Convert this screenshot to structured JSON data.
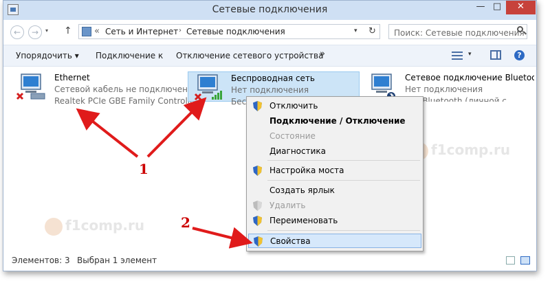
{
  "window": {
    "title": "Сетевые подключения",
    "controls": {
      "minimize": "—",
      "maximize": "□",
      "close": "✕"
    }
  },
  "nav": {
    "back": "←",
    "forward": "→",
    "recent": "▾",
    "up": "↑",
    "address_sep": "«",
    "breadcrumb": [
      "Сеть и Интернет",
      "Сетевые подключения"
    ],
    "crumb_arrow": "›",
    "address_dropdown": "▾",
    "refresh": "↻",
    "search_placeholder": "Поиск: Сетевые подключения"
  },
  "toolbar": {
    "organize": "Упорядочить ▾",
    "connect": "Подключение к",
    "disconnect": "Отключение сетевого устройства",
    "more": "»",
    "view_dropdown": "▾",
    "help": "?"
  },
  "connections": [
    {
      "name": "Ethernet",
      "status": "Сетевой кабель не подключен",
      "device": "Realtek PCIe GBE Family Controller",
      "selected": false
    },
    {
      "name": "Беспроводная сеть",
      "status": "Нет подключения",
      "device": "Беспр",
      "selected": true
    },
    {
      "name": "Сетевое подключение Bluetooth",
      "status": "Нет подключения",
      "device": "сти Bluetooth (личной с",
      "selected": false
    }
  ],
  "context_menu": [
    {
      "label": "Отключить",
      "shield": true,
      "bold": false,
      "disabled": false
    },
    {
      "label": "Подключение / Отключение",
      "shield": false,
      "bold": true,
      "disabled": false
    },
    {
      "label": "Состояние",
      "shield": false,
      "bold": false,
      "disabled": true
    },
    {
      "label": "Диагностика",
      "shield": false,
      "bold": false,
      "disabled": false
    },
    {
      "label": "Настройка моста",
      "shield": true,
      "bold": false,
      "disabled": false
    },
    {
      "label": "Создать ярлык",
      "shield": false,
      "bold": false,
      "disabled": false
    },
    {
      "label": "Удалить",
      "shield": true,
      "bold": false,
      "disabled": true
    },
    {
      "label": "Переименовать",
      "shield": true,
      "bold": false,
      "disabled": false
    },
    {
      "label": "Свойства",
      "shield": true,
      "bold": false,
      "disabled": false,
      "highlighted": true
    }
  ],
  "status": {
    "count": "Элементов: 3",
    "selected": "Выбран 1 элемент"
  },
  "callouts": {
    "one": "1",
    "two": "2"
  },
  "watermark": "f1comp.ru",
  "colors": {
    "selection": "#cce4f7",
    "close_button": "#c7423b",
    "arrow": "#e01b1b",
    "callout": "#cc0000"
  }
}
